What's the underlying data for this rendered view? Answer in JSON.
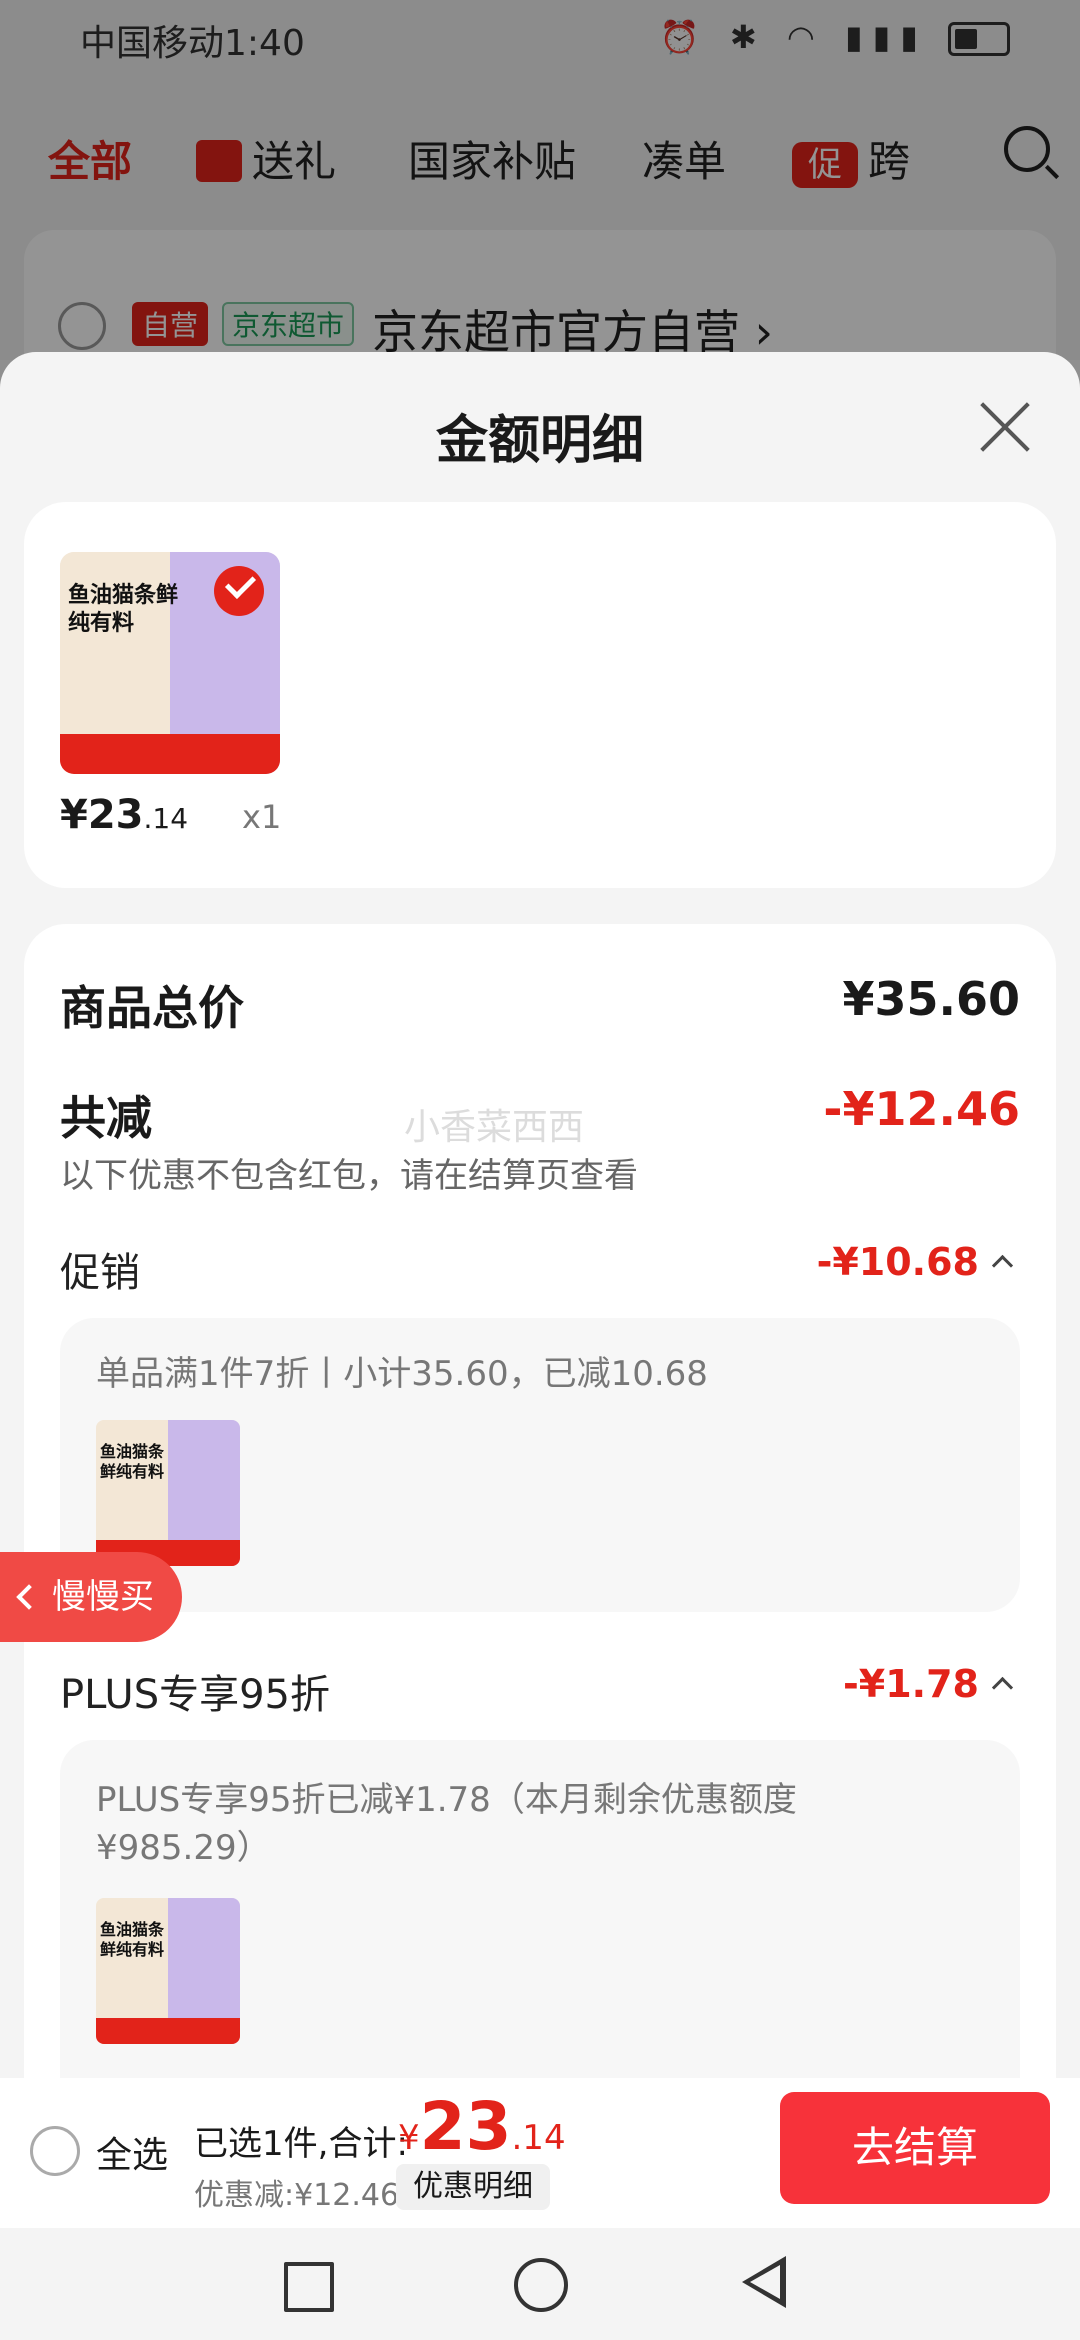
{
  "status_bar": {
    "carrier_time": "中国移动1:40"
  },
  "top_tabs": [
    {
      "label": "全部"
    },
    {
      "label": "送礼"
    },
    {
      "label": "国家补贴"
    },
    {
      "label": "凑单"
    },
    {
      "label": "跨"
    }
  ],
  "promo_badge": "促",
  "store": {
    "tag_self": "自营",
    "tag_market": "京东超市",
    "name": "京东超市官方自营 ›"
  },
  "sheet": {
    "title": "金额明细",
    "product": {
      "image_text": "鱼油猫条鲜纯有料",
      "price_int": "¥23",
      "price_dec": ".14",
      "qty": "x1"
    },
    "summary": {
      "total_label": "商品总价",
      "total_value": "¥35.60",
      "reduce_label": "共减",
      "reduce_value": "-¥12.46",
      "note": "以下优惠不包含红包，请在结算页查看",
      "watermark": "小香菜西西"
    },
    "promo": {
      "label": "促销",
      "value": "-¥10.68",
      "detail": "单品满1件7折丨小计35.60，已减10.68"
    },
    "plus": {
      "label": "PLUS专享95折",
      "value": "-¥1.78",
      "detail_line1": "PLUS专享95折已减¥1.78（本月剩余优惠额度",
      "detail_line2": "¥985.29）"
    }
  },
  "slow_buy": "慢慢买",
  "bottom_bar": {
    "select_all": "全选",
    "selected_text": "已选1件,合计:",
    "total_currency": "¥",
    "total_int": "23",
    "total_dec": ".14",
    "discount_text": "优惠减:¥12.46",
    "detail_button": "优惠明细",
    "checkout_button": "去结算"
  },
  "colors": {
    "accent": "#e2231a",
    "checkout": "#f7323a"
  }
}
